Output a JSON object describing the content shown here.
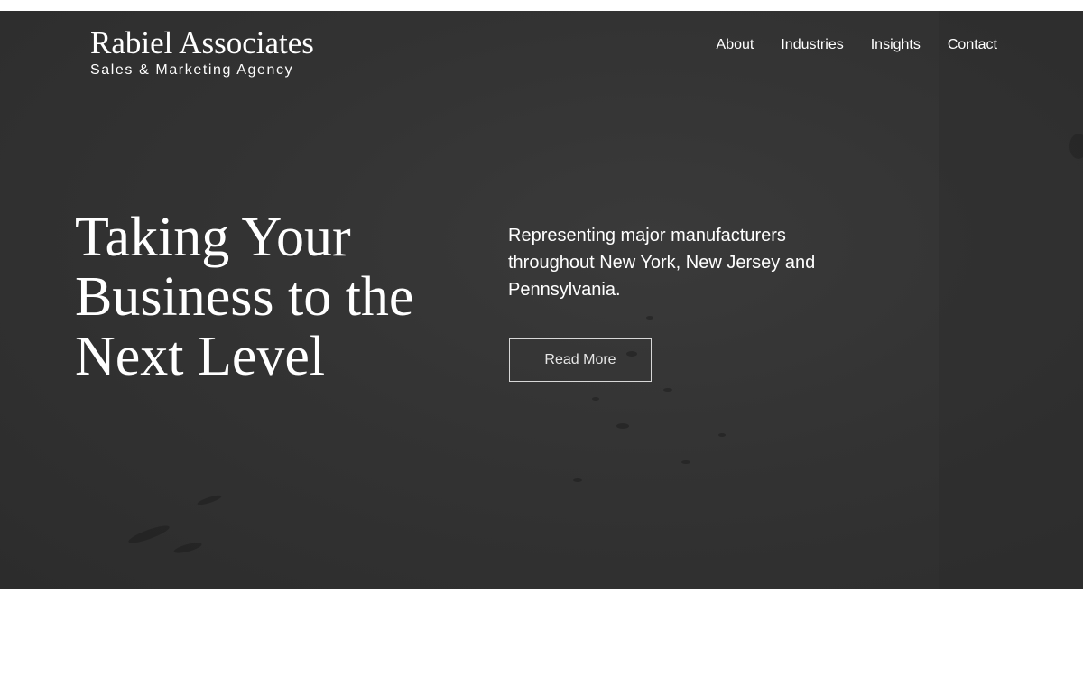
{
  "header": {
    "brand_name": "Rabiel Associates",
    "tagline": "Sales & Marketing Agency"
  },
  "nav": {
    "items": [
      {
        "label": "About"
      },
      {
        "label": "Industries"
      },
      {
        "label": "Insights"
      },
      {
        "label": "Contact"
      }
    ]
  },
  "hero": {
    "headline": "Taking Your Business to the Next Level",
    "intro": "Representing major manufacturers throughout New York, New Jersey and Pennsylvania.",
    "cta_label": "Read More"
  },
  "colors": {
    "hero_overlay": "#333333",
    "text": "#ffffff",
    "page_background": "#ffffff"
  }
}
